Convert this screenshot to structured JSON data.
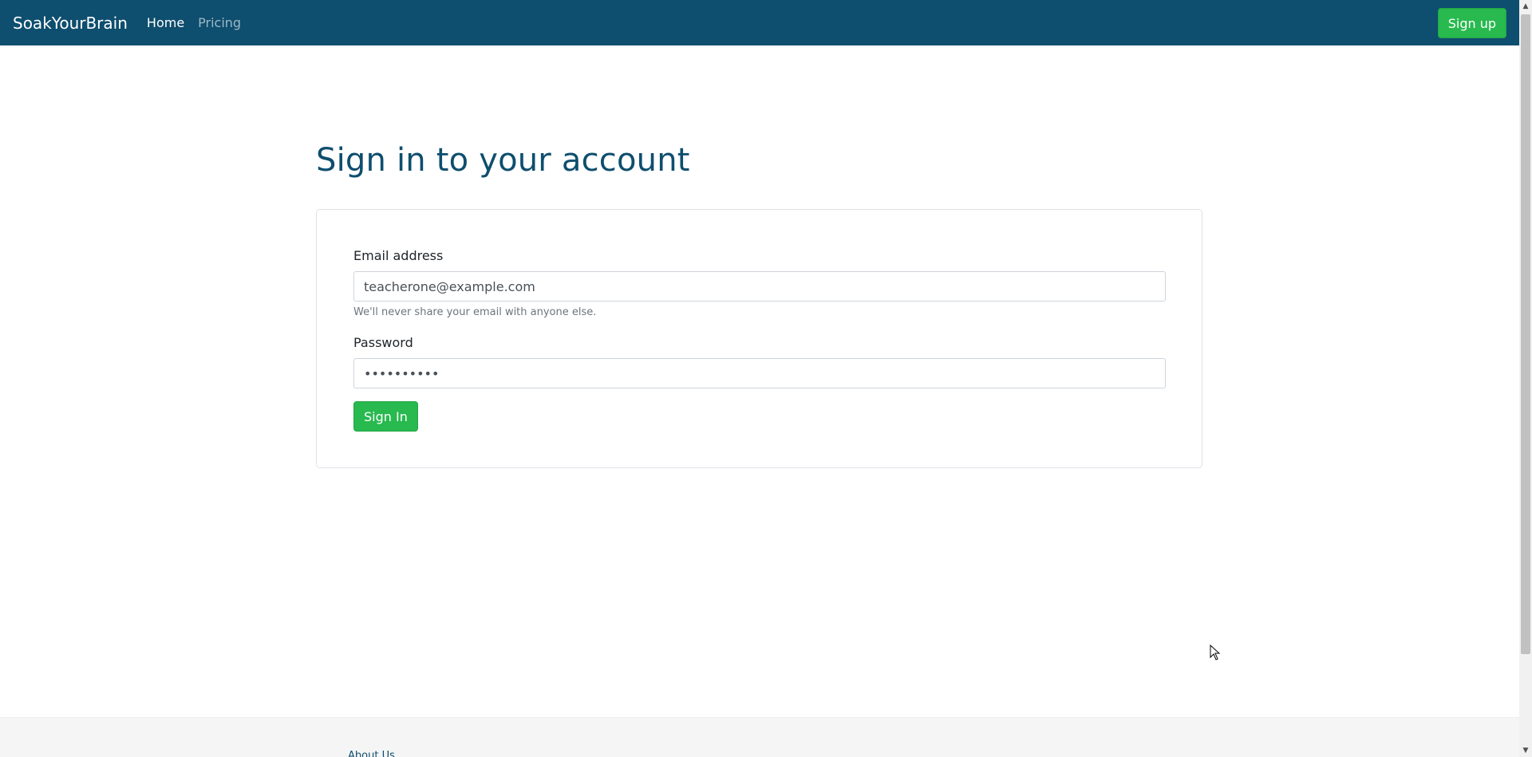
{
  "navbar": {
    "brand": "SoakYourBrain",
    "links": [
      {
        "label": "Home"
      },
      {
        "label": "Pricing"
      }
    ],
    "signup_label": "Sign up"
  },
  "main": {
    "title": "Sign in to your account",
    "form": {
      "email_label": "Email address",
      "email_value": "teacherone@example.com",
      "email_help": "We'll never share your email with anyone else.",
      "password_label": "Password",
      "password_value": "••••••••••",
      "submit_label": "Sign In"
    }
  },
  "footer": {
    "about_label": "About Us"
  },
  "colors": {
    "navbar_bg": "#0e4e6e",
    "brand_accent": "#0e4e6e",
    "button_green": "#28b94f"
  },
  "icons": {
    "scroll_up": "chevron-up-icon",
    "scroll_down": "chevron-down-icon",
    "cursor": "mouse-pointer-icon"
  }
}
